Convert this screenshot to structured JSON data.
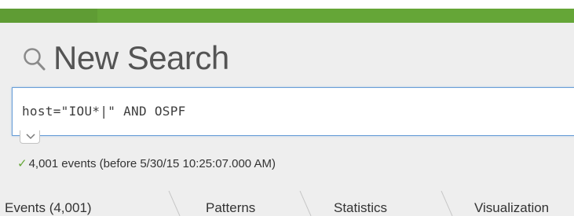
{
  "progress": 0.17,
  "colors": {
    "progress_bar": "#65a637",
    "check": "#65a637",
    "search_focus_border": "#6aa0d8"
  },
  "header": {
    "title": "New Search",
    "icon": "search-icon"
  },
  "search": {
    "query": "host=\"IOU*|\" AND OSPF"
  },
  "status": {
    "icon": "check-icon",
    "text": "4,001 events (before 5/30/15 10:25:07.000 AM)"
  },
  "tabs": [
    {
      "label": "Events (4,001)"
    },
    {
      "label": "Patterns"
    },
    {
      "label": "Statistics"
    },
    {
      "label": "Visualization"
    }
  ]
}
